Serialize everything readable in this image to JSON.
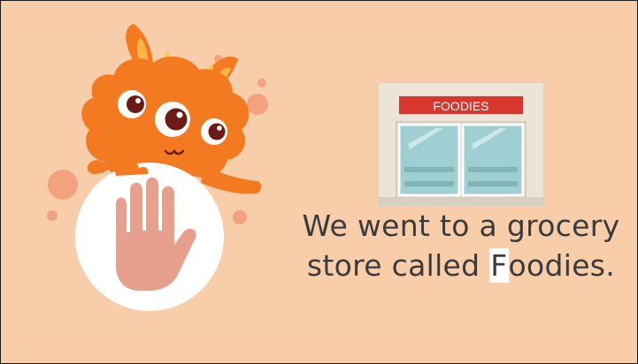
{
  "scene": {
    "store_sign": "FOODIES",
    "caption": {
      "line1": "We went to a grocery",
      "line2_before": "store called ",
      "line2_highlight": "F",
      "line2_after": "oodies."
    }
  },
  "icons": [
    "monster-mascot-icon",
    "stop-hand-icon",
    "grocery-store-icon"
  ],
  "colors": {
    "background": "#f8cda9",
    "monster": "#f47a22",
    "hand": "#e8a08e",
    "sign": "#d9372d"
  }
}
